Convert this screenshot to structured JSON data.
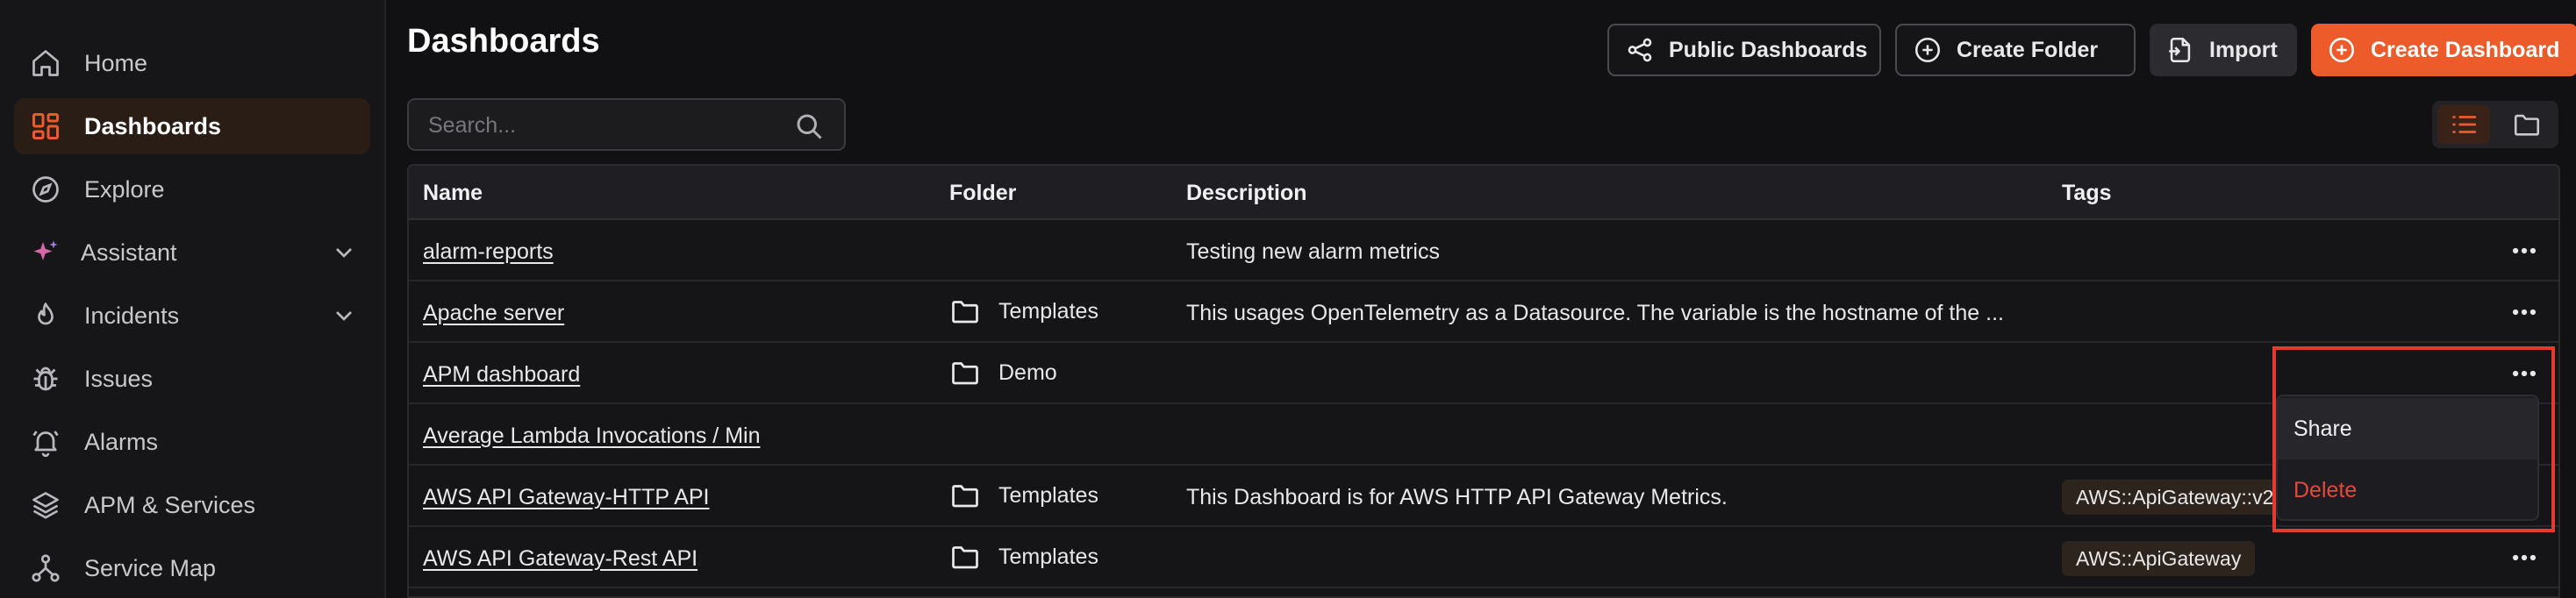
{
  "sidebar": {
    "items": [
      {
        "label": "Home",
        "icon": "home-icon"
      },
      {
        "label": "Dashboards",
        "icon": "dashboards-icon",
        "active": true
      },
      {
        "label": "Explore",
        "icon": "compass-icon"
      },
      {
        "label": "Assistant",
        "icon": "sparkle-icon",
        "expandable": true
      },
      {
        "label": "Incidents",
        "icon": "flame-icon",
        "expandable": true
      },
      {
        "label": "Issues",
        "icon": "bug-icon"
      },
      {
        "label": "Alarms",
        "icon": "alarm-bell-icon"
      },
      {
        "label": "APM & Services",
        "icon": "layers-icon"
      },
      {
        "label": "Service Map",
        "icon": "service-map-icon"
      }
    ]
  },
  "header": {
    "title": "Dashboards",
    "buttons": {
      "public_dashboards": "Public Dashboards",
      "create_folder": "Create Folder",
      "import": "Import",
      "create_dashboard": "Create Dashboard"
    }
  },
  "search": {
    "placeholder": "Search...",
    "value": ""
  },
  "view_toggle": {
    "selected": "list",
    "options": [
      "list",
      "folder"
    ]
  },
  "table": {
    "columns": {
      "name": "Name",
      "folder": "Folder",
      "description": "Description",
      "tags": "Tags"
    },
    "rows": [
      {
        "name": "alarm-reports",
        "folder": "",
        "description": "Testing new alarm metrics",
        "tag": ""
      },
      {
        "name": "Apache server",
        "folder": "Templates",
        "description": "This usages OpenTelemetry as a Datasource. The variable is the hostname of the ...",
        "tag": ""
      },
      {
        "name": "APM dashboard",
        "folder": "Demo",
        "description": "",
        "tag": ""
      },
      {
        "name": "Average Lambda Invocations / Min",
        "folder": "",
        "description": "",
        "tag": ""
      },
      {
        "name": "AWS API Gateway-HTTP API",
        "folder": "Templates",
        "description": "This Dashboard is for AWS HTTP API Gateway Metrics.",
        "tag": "AWS::ApiGateway::v2"
      },
      {
        "name": "AWS API Gateway-Rest API",
        "folder": "Templates",
        "description": "",
        "tag": "AWS::ApiGateway"
      }
    ]
  },
  "row_menu": {
    "items": [
      {
        "label": "Share"
      },
      {
        "label": "Delete"
      }
    ]
  },
  "colors": {
    "accent": "#ee5b2b",
    "danger": "#e5483a",
    "highlight_box": "#e53a32",
    "background": "#111113",
    "sidebar": "#161618"
  }
}
